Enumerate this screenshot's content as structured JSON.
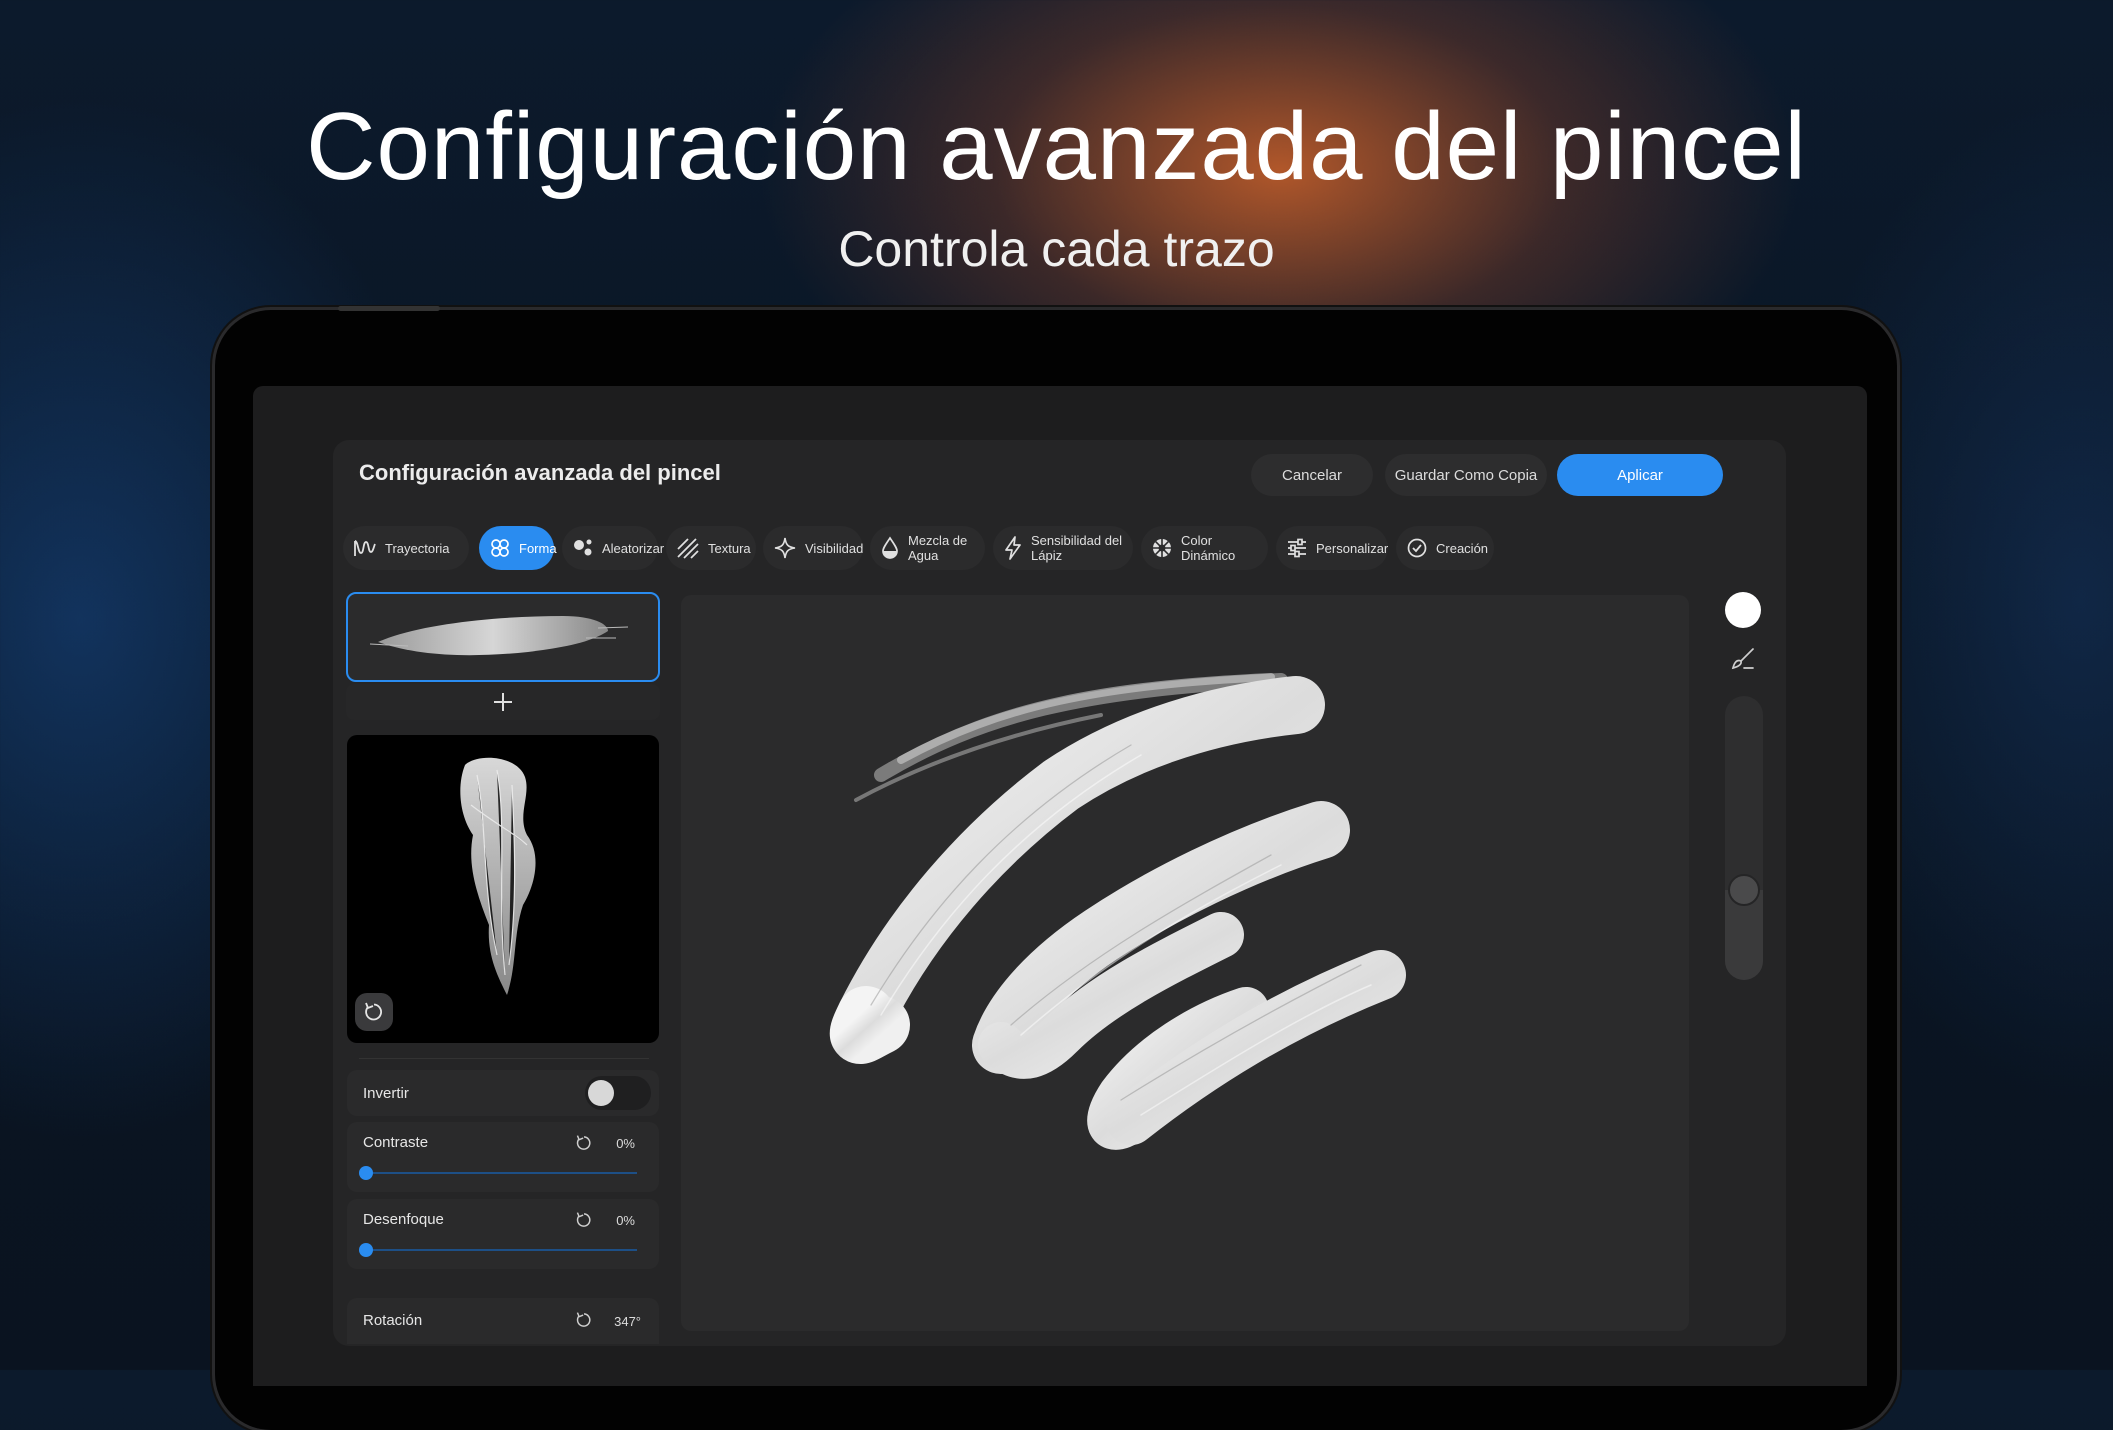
{
  "hero": {
    "title": "Configuración avanzada del pincel",
    "subtitle": "Controla cada trazo"
  },
  "dialog": {
    "title": "Configuración avanzada del pincel",
    "cancel_label": "Cancelar",
    "save_copy_label": "Guardar Como Copia",
    "apply_label": "Aplicar"
  },
  "tabs": [
    {
      "label": "Trayectoria",
      "icon": "path-wave-icon",
      "active": false
    },
    {
      "label": "Forma",
      "icon": "flower-shape-icon",
      "active": true
    },
    {
      "label": "Aleatorizar",
      "icon": "dots-icon",
      "active": false
    },
    {
      "label": "Textura",
      "icon": "hatch-lines-icon",
      "active": false
    },
    {
      "label": "Visibilidad",
      "icon": "sparkle-icon",
      "active": false
    },
    {
      "label": "Mezcla de Agua",
      "icon": "water-drop-icon",
      "active": false
    },
    {
      "label": "Sensibilidad del Lápiz",
      "icon": "lightning-icon",
      "active": false
    },
    {
      "label": "Color Dinámico",
      "icon": "color-wheel-icon",
      "active": false
    },
    {
      "label": "Personalizar",
      "icon": "sliders-icon",
      "active": false
    },
    {
      "label": "Creación",
      "icon": "check-badge-icon",
      "active": false
    }
  ],
  "settings": {
    "invert": {
      "label": "Invertir",
      "on": false
    },
    "contrast": {
      "label": "Contraste",
      "value": "0%",
      "level": 0
    },
    "blur": {
      "label": "Desenfoque",
      "value": "0%",
      "level": 0
    },
    "rotation": {
      "label": "Rotación",
      "value": "347°"
    }
  },
  "colors": {
    "accent": "#2a8cf0",
    "panel": "#252526",
    "canvas": "#2b2b2c",
    "brush_color": "#ffffff"
  }
}
